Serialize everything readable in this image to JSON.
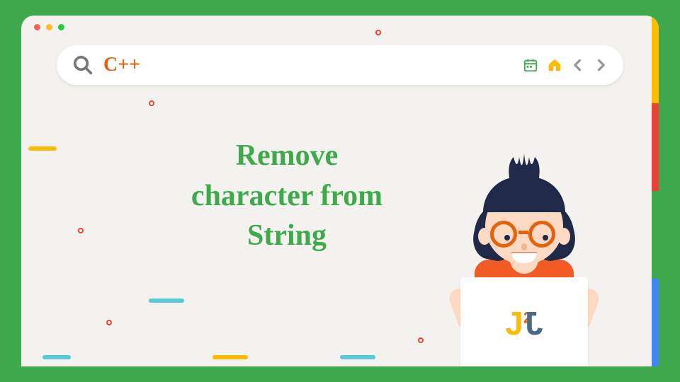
{
  "search": {
    "query": "C++"
  },
  "title": {
    "line1": "Remove",
    "line2": "character from",
    "line3": "String"
  },
  "logo": {
    "j": "J",
    "sup": "2",
    "b": "J"
  },
  "colors": {
    "green": "#3fa94e",
    "orange": "#e2620e",
    "red": "#ea4335",
    "yellow": "#fbbc05",
    "blue": "#4285f4",
    "navy": "#1e2a47",
    "skin": "#fcd9c2",
    "shirt": "#f15a24"
  },
  "icons": {
    "search": "search-icon",
    "calendar": "calendar-icon",
    "home": "home-icon",
    "back": "chevron-left-icon",
    "forward": "chevron-right-icon"
  }
}
